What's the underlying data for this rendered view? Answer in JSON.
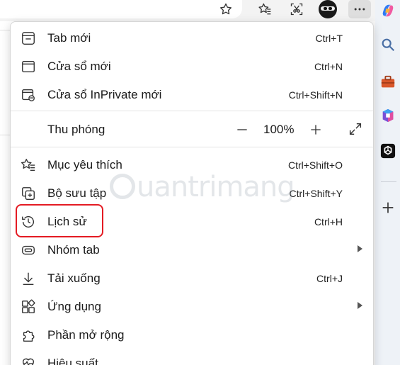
{
  "menu": {
    "items": [
      {
        "label": "Tab mới",
        "shortcut": "Ctrl+T"
      },
      {
        "label": "Cửa sổ mới",
        "shortcut": "Ctrl+N"
      },
      {
        "label": "Cửa sổ InPrivate mới",
        "shortcut": "Ctrl+Shift+N"
      },
      {
        "label": "Mục yêu thích",
        "shortcut": "Ctrl+Shift+O"
      },
      {
        "label": "Bộ sưu tập",
        "shortcut": "Ctrl+Shift+Y"
      },
      {
        "label": "Lịch sử",
        "shortcut": "Ctrl+H"
      },
      {
        "label": "Nhóm tab",
        "shortcut": ""
      },
      {
        "label": "Tải xuống",
        "shortcut": "Ctrl+J"
      },
      {
        "label": "Ứng dụng",
        "shortcut": ""
      },
      {
        "label": "Phần mở rộng",
        "shortcut": ""
      },
      {
        "label": "Hiệu suất",
        "shortcut": ""
      }
    ],
    "zoom": {
      "label": "Thu phóng",
      "value": "100%",
      "minus_glyph": "—",
      "plus_glyph": "+"
    },
    "highlighted_item": "Lịch sử"
  },
  "watermark": {
    "text": "uantrimang"
  },
  "colors": {
    "highlight_border": "#e41b23",
    "sidebar_bg": "#eef2f7",
    "menu_bg": "#ffffff"
  },
  "icons": {
    "toolbar": [
      "star-outline-icon",
      "favorites-star-icon",
      "screenshot-scissors-icon",
      "profile-avatar-icon",
      "more-dots-icon"
    ],
    "sidebar": [
      "copilot-icon",
      "search-icon",
      "toolbox-icon",
      "office-icon",
      "chatgpt-icon",
      "add-icon"
    ]
  }
}
